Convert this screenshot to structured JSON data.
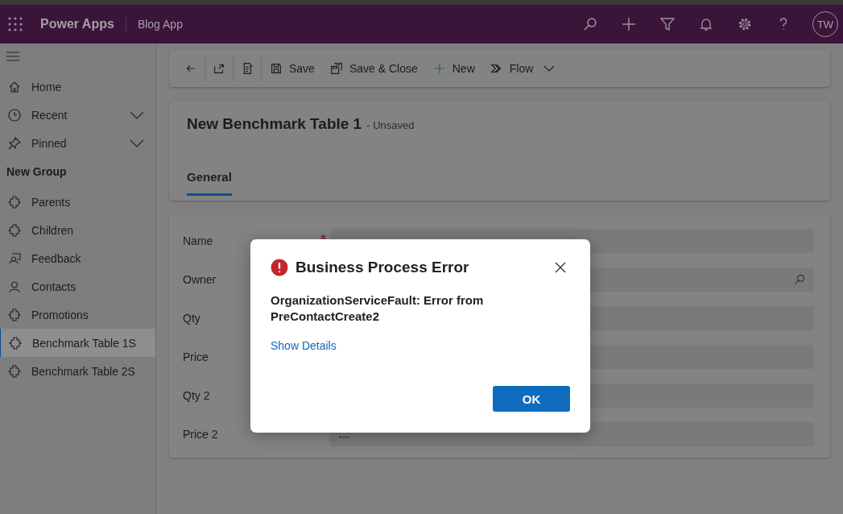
{
  "app_bar": {
    "product": "Power Apps",
    "app_name": "Blog App",
    "avatar": "TW"
  },
  "sidebar": {
    "items": [
      {
        "label": "Home",
        "kind": "home",
        "selected": false
      },
      {
        "label": "Recent",
        "kind": "recent",
        "selected": false
      },
      {
        "label": "Pinned",
        "kind": "pinned",
        "selected": false
      }
    ],
    "groups": [
      {
        "heading": "New Group",
        "items": [
          {
            "label": "Parents",
            "kind": "table",
            "selected": false
          },
          {
            "label": "Children",
            "kind": "table",
            "selected": false
          },
          {
            "label": "Feedback",
            "kind": "feedback",
            "selected": false
          },
          {
            "label": "Contacts",
            "kind": "contact",
            "selected": false
          },
          {
            "label": "Promotions",
            "kind": "table",
            "selected": false
          },
          {
            "label": "Benchmark Table 1S",
            "kind": "table",
            "selected": true
          },
          {
            "label": "Benchmark Table 2S",
            "kind": "table",
            "selected": false
          }
        ]
      }
    ]
  },
  "toolbar": [
    {
      "kind": "back"
    },
    {
      "kind": "popout"
    },
    {
      "kind": "check"
    },
    {
      "kind": "save",
      "label": "Save"
    },
    {
      "kind": "save-close",
      "label": "Save & Close"
    },
    {
      "kind": "new",
      "label": "New"
    },
    {
      "kind": "flow",
      "label": "Flow"
    }
  ],
  "record": {
    "title": "New Benchmark Table 1",
    "status": "- Unsaved",
    "tabs": [
      {
        "label": "General",
        "selected": true
      }
    ]
  },
  "fields": [
    {
      "label": "Name",
      "required": true,
      "kind": "text"
    },
    {
      "label": "Owner",
      "required": false,
      "kind": "lookup"
    },
    {
      "label": "Qty",
      "required": false,
      "kind": "text"
    },
    {
      "label": "Price",
      "required": false,
      "kind": "text"
    },
    {
      "label": "Qty 2",
      "required": false,
      "kind": "text"
    },
    {
      "label": "Price 2",
      "required": false,
      "kind": "text",
      "value": "---"
    }
  ],
  "dialog": {
    "title": "Business Process Error",
    "message": "OrganizationServiceFault: Error from PreContactCreate2",
    "link": "Show Details",
    "button": "OK"
  }
}
